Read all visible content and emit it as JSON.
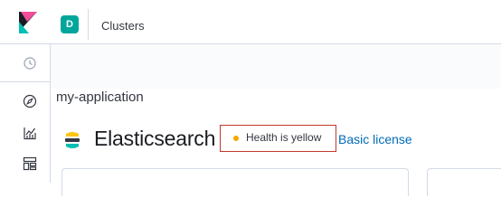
{
  "header": {
    "space_initial": "D",
    "breadcrumb": "Clusters"
  },
  "nav": {
    "items": [
      {
        "icon": "clock-icon"
      },
      {
        "icon": "discover-icon"
      },
      {
        "icon": "visualize-icon"
      },
      {
        "icon": "dashboard-icon"
      }
    ]
  },
  "cluster": {
    "name": "my-application",
    "product": "Elasticsearch",
    "health_label": "Health is yellow",
    "health_color": "#f5a700",
    "license_link": "Basic license"
  },
  "colors": {
    "accent": "#00a69b",
    "link": "#006bb8",
    "highlight_border": "#c0392b"
  }
}
